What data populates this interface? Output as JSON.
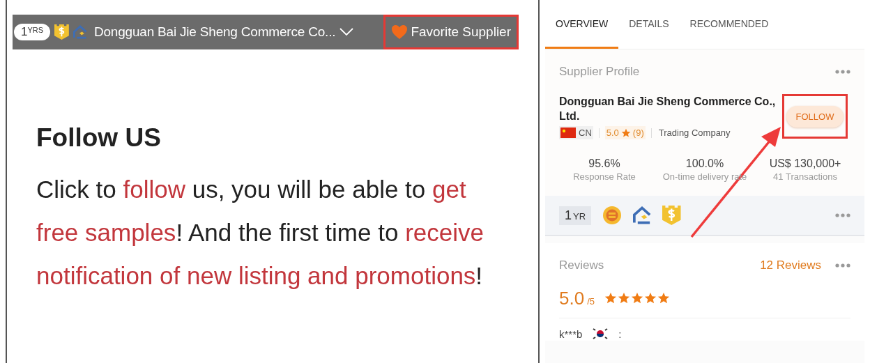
{
  "store_header": {
    "years": "1",
    "years_unit": "YRS",
    "company": "Dongguan Bai Jie Sheng Commerce Co...",
    "favorite": {
      "label": "Favorite Supplier",
      "highlighted": true
    }
  },
  "promo": {
    "heading": "Follow US",
    "paragraph": [
      {
        "text": "Click to ",
        "emphasis": false
      },
      {
        "text": "follow",
        "emphasis": true
      },
      {
        "text": " us, you will be able to ",
        "emphasis": false
      },
      {
        "text": "get free samples",
        "emphasis": true
      },
      {
        "text": "! And the first time to ",
        "emphasis": false
      },
      {
        "text": "receive notification of new listing and promotions",
        "emphasis": true
      },
      {
        "text": "!",
        "emphasis": false
      }
    ]
  },
  "tabs": [
    {
      "label": "OVERVIEW",
      "selected": true
    },
    {
      "label": "DETAILS",
      "selected": false
    },
    {
      "label": "RECOMMENDED",
      "selected": false
    }
  ],
  "profile": {
    "title": "Supplier Profile",
    "name": "Dongguan Bai Jie Sheng Commerce Co., Ltd.",
    "country": "CN",
    "rating": "5.0",
    "rating_count": "(9)",
    "business_type": "Trading Company",
    "follow": {
      "label": "FOLLOW",
      "highlighted": true
    },
    "stats": [
      {
        "value": "95.6%",
        "label": "Response Rate"
      },
      {
        "value": "100.0%",
        "label": "On-time delivery rate"
      },
      {
        "value": "US$ 130,000+",
        "label": "41 Transactions"
      }
    ],
    "years": "1",
    "years_unit": "YR"
  },
  "reviews": {
    "title": "Reviews",
    "count_link": "12 Reviews",
    "score": "5.0",
    "scale": "/5",
    "stars": 5,
    "reviewer": "k***b",
    "separator": ":"
  },
  "annotation_arrow": true
}
